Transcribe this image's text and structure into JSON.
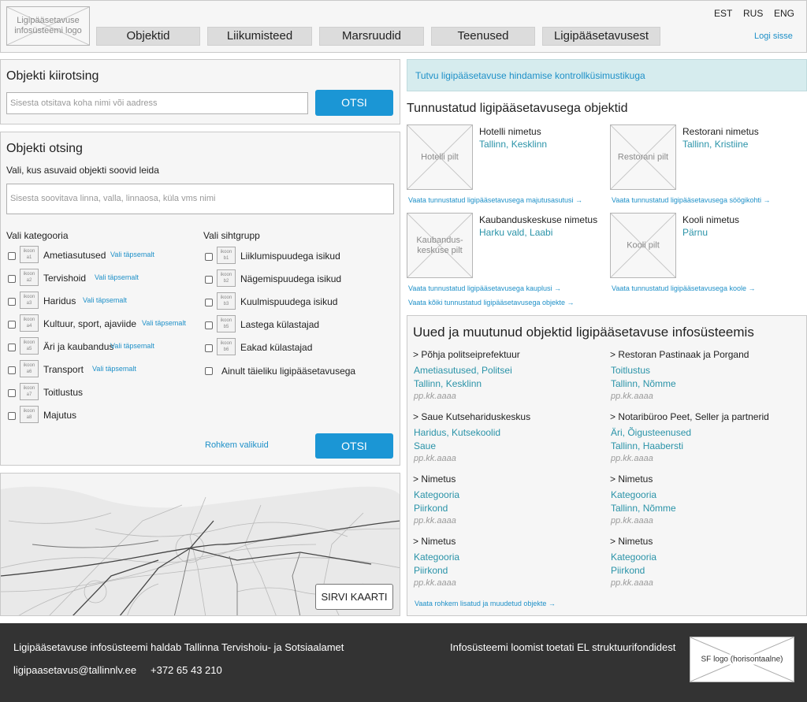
{
  "header": {
    "logo": "Ligipääsetavuse infosüsteemi logo",
    "nav": [
      "Objektid",
      "Liikumisteed",
      "Marsruudid",
      "Teenused",
      "Ligipääsetavusest"
    ],
    "langs": [
      "EST",
      "RUS",
      "ENG"
    ],
    "login": "Logi sisse"
  },
  "quick_search": {
    "title": "Objekti kiirotsing",
    "placeholder": "Sisesta otsitava koha nimi või aadress",
    "button": "OTSI"
  },
  "search": {
    "title": "Objekti otsing",
    "subtitle": "Vali, kus asuvaid objekti soovid leida",
    "placeholder": "Sisesta soovitava linna, valla, linnaosa, küla vms nimi",
    "category_heading": "Vali kategooria",
    "target_heading": "Vali sihtgrupp",
    "refine": "Vali täpsemalt",
    "categories": [
      {
        "icon": "ikoon a1",
        "label": "Ametiasutused",
        "refine": true
      },
      {
        "icon": "ikoon a2",
        "label": "Tervishoid",
        "refine": true
      },
      {
        "icon": "ikoon a3",
        "label": "Haridus",
        "refine": true
      },
      {
        "icon": "ikoon a4",
        "label": "Kultuur, sport, ajaviide",
        "refine": true
      },
      {
        "icon": "ikoon a5",
        "label": "Äri ja kaubandus",
        "refine": true
      },
      {
        "icon": "ikoon a6",
        "label": "Transport",
        "refine": true
      },
      {
        "icon": "ikoon a7",
        "label": "Toitlustus",
        "refine": false
      },
      {
        "icon": "ikoon a8",
        "label": "Majutus",
        "refine": false
      }
    ],
    "targets": [
      {
        "icon": "ikoon b1",
        "label": "Liiklumispuudega isikud"
      },
      {
        "icon": "ikoon b2",
        "label": "Nägemispuudega isikud"
      },
      {
        "icon": "ikoon b3",
        "label": "Kuulmispuudega isikud"
      },
      {
        "icon": "ikoon b5",
        "label": "Lastega külastajad"
      },
      {
        "icon": "ikoon b6",
        "label": "Eakad külastajad"
      }
    ],
    "full_access": "Ainult täieliku ligipääsetavusega",
    "more_options": "Rohkem valikuid",
    "button": "OTSI"
  },
  "map": {
    "button": "SIRVI KAARTI"
  },
  "banner": "Tutvu ligipääsetavuse hindamise kontrollküsimustikuga",
  "certified": {
    "title": "Tunnustatud ligipääsetavusega objektid",
    "items": [
      {
        "img": "Hotelli pilt",
        "name": "Hotelli nimetus",
        "loc": "Tallinn, Kesklinn",
        "link": "Vaata tunnustatud ligipääsetavusega majutusasutusi →"
      },
      {
        "img": "Restorani pilt",
        "name": "Restorani nimetus",
        "loc": "Tallinn, Kristiine",
        "link": "Vaata tunnustatud ligipääsetavusega söögikohti →"
      },
      {
        "img": "Kaubandus-keskuse pilt",
        "name": "Kaubanduskeskuse nimetus",
        "loc": "Harku vald, Laabi",
        "link": "Vaata tunnustatud ligipääsetavusega kauplusi →"
      },
      {
        "img": "Kooli pilt",
        "name": "Kooli nimetus",
        "loc": "Pärnu",
        "link": "Vaata tunnustatud ligipääsetavusega koole →"
      }
    ],
    "all_link": "Vaata kõiki tunnustatud ligipääsetavusega objekte →"
  },
  "recent": {
    "title": "Uued ja muutunud objektid ligipääsetavuse infosüsteemis",
    "items": [
      {
        "name": "> Põhja politseiprefektuur",
        "cat": "Ametiasutused, Politsei",
        "loc": "Tallinn, Kesklinn",
        "date": "pp.kk.aaaa"
      },
      {
        "name": "> Restoran Pastinaak ja Porgand",
        "cat": "Toitlustus",
        "loc": "Tallinn, Nõmme",
        "date": "pp.kk.aaaa"
      },
      {
        "name": "> Saue Kutsehariduskeskus",
        "cat": "Haridus, Kutsekoolid",
        "loc": "Saue",
        "date": "pp.kk.aaaa"
      },
      {
        "name": "> Notaribüroo Peet, Seller ja partnerid",
        "cat": "Äri, Õigusteenused",
        "loc": "Tallinn, Haabersti",
        "date": "pp.kk.aaaa"
      },
      {
        "name": "> Nimetus",
        "cat": "Kategooria",
        "loc": "Piirkond",
        "date": "pp.kk.aaaa"
      },
      {
        "name": "> Nimetus",
        "cat": "Kategooria",
        "loc": "Tallinn, Nõmme",
        "date": "pp.kk.aaaa"
      },
      {
        "name": "> Nimetus",
        "cat": "Kategooria",
        "loc": "Piirkond",
        "date": "pp.kk.aaaa"
      },
      {
        "name": "> Nimetus",
        "cat": "Kategooria",
        "loc": "Piirkond",
        "date": "pp.kk.aaaa"
      }
    ],
    "more_link": "Vaata rohkem lisatud ja muudetud objekte →"
  },
  "footer": {
    "maintainer": "Ligipääsetavuse infosüsteemi haldab Tallinna Tervishoiu- ja Sotsiaalamet",
    "email": "ligipaasetavus@tallinnlv.ee",
    "phone": "+372 65 43 210",
    "funding": "Infosüsteemi loomist toetati EL struktuurifondidest",
    "sf_logo": "SF logo (horisontaalne)"
  }
}
